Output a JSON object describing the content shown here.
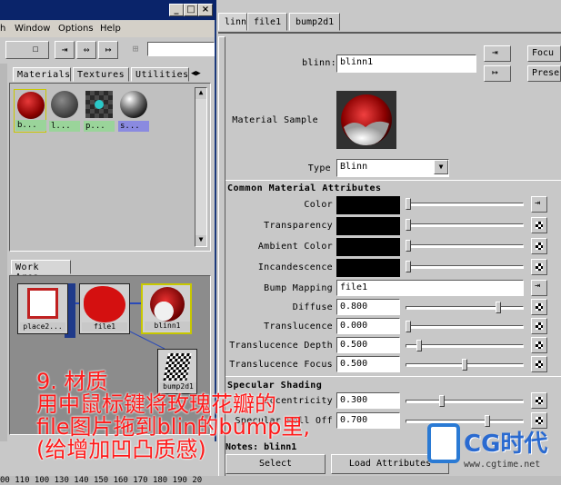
{
  "hypershade": {
    "menus": [
      "h",
      "Window",
      "Options",
      "Help"
    ],
    "tabs": [
      "Materials",
      "Textures",
      "Utilities"
    ],
    "materials": [
      {
        "label": "b...",
        "color": "#b81e1e"
      },
      {
        "label": "l...",
        "color": "#6e6e6e"
      },
      {
        "label": "p...",
        "color": "#3a8a8a"
      },
      {
        "label": "s...",
        "color": "#5a5a5a"
      }
    ],
    "work_area_tab": "Work Area",
    "nodes": {
      "place2d": "place2...",
      "file": "file1",
      "blinn": "blinn1",
      "bump": "bump2d1"
    }
  },
  "attr": {
    "tabs": [
      "linn1",
      "file1",
      "bump2d1"
    ],
    "focus_label": "Focu",
    "presets_label": "Prese",
    "name_label": "blinn:",
    "name_value": "blinn1",
    "sample_label": "Material Sample",
    "type_label": "Type",
    "type_value": "Blinn",
    "common_header": "Common Material Attributes",
    "color_rows": [
      {
        "label": "Color",
        "thumb": 0.0
      },
      {
        "label": "Transparency",
        "thumb": 0.0
      },
      {
        "label": "Ambient Color",
        "thumb": 0.0
      },
      {
        "label": "Incandescence",
        "thumb": 0.0
      }
    ],
    "bump_label": "Bump Mapping",
    "bump_value": "file1",
    "num_rows": [
      {
        "label": "Diffuse",
        "value": "0.800",
        "thumb": 0.8
      },
      {
        "label": "Translucence",
        "value": "0.000",
        "thumb": 0.0
      },
      {
        "label": "Translucence Depth",
        "value": "0.500",
        "thumb": 0.1
      },
      {
        "label": "Translucence Focus",
        "value": "0.500",
        "thumb": 0.5
      }
    ],
    "specular_header": "Specular Shading",
    "spec_rows": [
      {
        "label": "Eccentricity",
        "value": "0.300",
        "thumb": 0.3
      },
      {
        "label": "Specular Roll Off",
        "value": "0.700",
        "thumb": 0.7
      }
    ],
    "notes_label": "Notes: blinn1",
    "select_label": "Select",
    "load_label": "Load Attributes"
  },
  "overlay": {
    "line1": "9. 材质",
    "line2": "用中鼠标键将玫瑰花瓣的",
    "line3": "file图片拖到blin的bump里,",
    "line4": "(给增加凹凸质感)"
  },
  "logo": {
    "text": "CG时代",
    "url": "www.cgtime.net"
  },
  "ruler": "00  110  100  130  140  150  160  170  180  190  20"
}
